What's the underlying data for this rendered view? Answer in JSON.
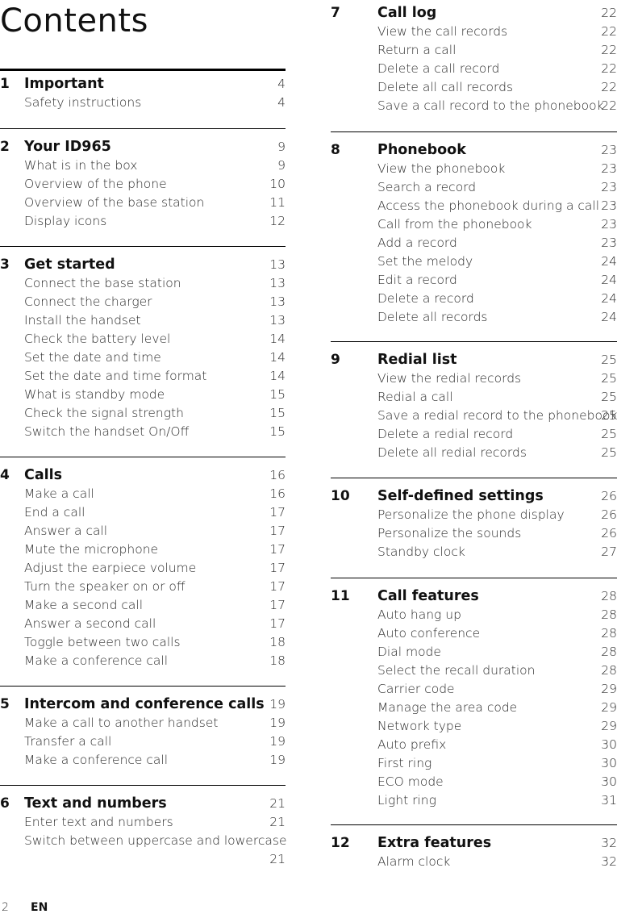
{
  "page": {
    "title": "Contents",
    "footer_page_number": "2",
    "footer_language": "EN"
  },
  "sections": [
    {
      "number": "1",
      "title": "Important",
      "page": "4",
      "items": [
        {
          "label": "Safety instructions",
          "page": "4"
        }
      ]
    },
    {
      "number": "2",
      "title": "Your ID965",
      "page": "9",
      "items": [
        {
          "label": "What is in the box",
          "page": "9"
        },
        {
          "label": "Overview of the phone",
          "page": "10"
        },
        {
          "label": "Overview of the base station",
          "page": "11"
        },
        {
          "label": "Display icons",
          "page": "12"
        }
      ]
    },
    {
      "number": "3",
      "title": "Get started",
      "page": "13",
      "items": [
        {
          "label": "Connect the base station",
          "page": "13"
        },
        {
          "label": "Connect the charger",
          "page": "13"
        },
        {
          "label": "Install the handset",
          "page": "13"
        },
        {
          "label": "Check the battery level",
          "page": "14"
        },
        {
          "label": "Set the date and time",
          "page": "14"
        },
        {
          "label": "Set the date and time format",
          "page": "14"
        },
        {
          "label": "What is standby mode",
          "page": "15"
        },
        {
          "label": "Check the signal strength",
          "page": "15"
        },
        {
          "label": "Switch the handset On/Off",
          "page": "15"
        }
      ]
    },
    {
      "number": "4",
      "title": "Calls",
      "page": "16",
      "items": [
        {
          "label": "Make a call",
          "page": "16"
        },
        {
          "label": "End a call",
          "page": "17"
        },
        {
          "label": "Answer a call",
          "page": "17"
        },
        {
          "label": "Mute the microphone",
          "page": "17"
        },
        {
          "label": "Adjust the earpiece volume",
          "page": "17"
        },
        {
          "label": "Turn the speaker on or off",
          "page": "17"
        },
        {
          "label": "Make a second call",
          "page": "17"
        },
        {
          "label": "Answer a second call",
          "page": "17"
        },
        {
          "label": "Toggle between two calls",
          "page": "18"
        },
        {
          "label": "Make a conference call",
          "page": "18"
        }
      ]
    },
    {
      "number": "5",
      "title": "Intercom and conference calls",
      "page": "19",
      "items": [
        {
          "label": "Make a call to another handset",
          "page": "19"
        },
        {
          "label": "Transfer a call",
          "page": "19"
        },
        {
          "label": "Make a conference call",
          "page": "19"
        }
      ]
    },
    {
      "number": "6",
      "title": "Text and numbers",
      "page": "21",
      "items": [
        {
          "label": "Enter text and numbers",
          "page": "21"
        },
        {
          "label": "Switch between uppercase and lowercase",
          "page": "21"
        }
      ]
    },
    {
      "number": "7",
      "title": "Call log",
      "page": "22",
      "items": [
        {
          "label": "View the call records",
          "page": "22"
        },
        {
          "label": "Return a call",
          "page": "22"
        },
        {
          "label": "Delete a call record",
          "page": "22"
        },
        {
          "label": "Delete all call records",
          "page": "22"
        },
        {
          "label": "Save a call record to the phonebook",
          "page": "22"
        }
      ]
    },
    {
      "number": "8",
      "title": "Phonebook",
      "page": "23",
      "items": [
        {
          "label": "View the phonebook",
          "page": "23"
        },
        {
          "label": "Search a record",
          "page": "23"
        },
        {
          "label": "Access the phonebook during a call",
          "page": "23"
        },
        {
          "label": "Call from the phonebook",
          "page": "23"
        },
        {
          "label": "Add a record",
          "page": "23"
        },
        {
          "label": "Set the melody",
          "page": "24"
        },
        {
          "label": "Edit a record",
          "page": "24"
        },
        {
          "label": "Delete a record",
          "page": "24"
        },
        {
          "label": "Delete all records",
          "page": "24"
        }
      ]
    },
    {
      "number": "9",
      "title": "Redial list",
      "page": "25",
      "items": [
        {
          "label": "View the redial records",
          "page": "25"
        },
        {
          "label": "Redial a call",
          "page": "25"
        },
        {
          "label": "Save a redial record to the phonebook",
          "page": "25"
        },
        {
          "label": "Delete a redial record",
          "page": "25"
        },
        {
          "label": "Delete all redial records",
          "page": "25"
        }
      ]
    },
    {
      "number": "10",
      "title": "Self-defined settings",
      "page": "26",
      "items": [
        {
          "label": "Personalize the phone display",
          "page": "26"
        },
        {
          "label": "Personalize the sounds",
          "page": "26"
        },
        {
          "label": "Standby clock",
          "page": "27"
        }
      ]
    },
    {
      "number": "11",
      "title": "Call features",
      "page": "28",
      "items": [
        {
          "label": "Auto hang up",
          "page": "28"
        },
        {
          "label": "Auto conference",
          "page": "28"
        },
        {
          "label": "Dial mode",
          "page": "28"
        },
        {
          "label": "Select the recall duration",
          "page": "28"
        },
        {
          "label": "Carrier code",
          "page": "29"
        },
        {
          "label": "Manage the area code",
          "page": "29"
        },
        {
          "label": "Network type",
          "page": "29"
        },
        {
          "label": "Auto prefix",
          "page": "30"
        },
        {
          "label": "First ring",
          "page": "30"
        },
        {
          "label": "ECO mode",
          "page": "30"
        },
        {
          "label": "Light ring",
          "page": "31"
        }
      ]
    },
    {
      "number": "12",
      "title": "Extra features",
      "page": "32",
      "items": [
        {
          "label": "Alarm clock",
          "page": "32"
        }
      ]
    }
  ]
}
